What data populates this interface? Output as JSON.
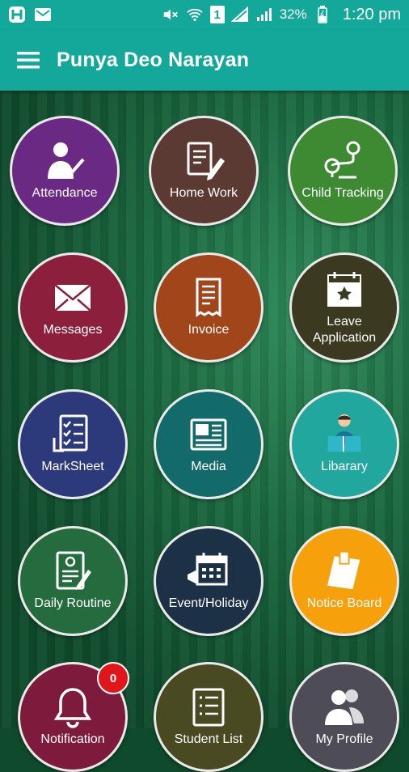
{
  "status_bar": {
    "battery": "32%",
    "time": "1:20 pm",
    "sim_slot": "1",
    "icons": [
      "app-icon",
      "mail-icon",
      "mute-icon",
      "wifi-icon",
      "sim-icon",
      "signal-icon",
      "signal-icon",
      "battery-icon"
    ]
  },
  "appbar": {
    "title": "Punya Deo Narayan"
  },
  "tiles": [
    {
      "label": "Attendance",
      "icon": "attendance-icon",
      "color": "#6a2a84"
    },
    {
      "label": "Home Work",
      "icon": "homework-icon",
      "color": "#5a3a32"
    },
    {
      "label": "Child Tracking",
      "icon": "route-icon",
      "color": "#3d8a33"
    },
    {
      "label": "Messages",
      "icon": "envelope-icon",
      "color": "#8c1f3c"
    },
    {
      "label": "Invoice",
      "icon": "receipt-icon",
      "color": "#a0461a"
    },
    {
      "label": "Leave Application",
      "icon": "calendar-star-icon",
      "color": "#3b3a20"
    },
    {
      "label": "MarkSheet",
      "icon": "checklist-icon",
      "color": "#2c3a7c"
    },
    {
      "label": "Media",
      "icon": "newspaper-icon",
      "color": "#136a6a"
    },
    {
      "label": "Libarary",
      "icon": "reader-icon",
      "color": "#21a79e"
    },
    {
      "label": "Daily Routine",
      "icon": "routine-icon",
      "color": "#246b3e"
    },
    {
      "label": "Event/Holiday",
      "icon": "event-calendar-icon",
      "color": "#1c3046"
    },
    {
      "label": "Notice Board",
      "icon": "notice-icon",
      "color": "#f6a00b"
    },
    {
      "label": "Notification",
      "icon": "bell-icon",
      "color": "#7e1a3c",
      "badge": "0"
    },
    {
      "label": "Student List",
      "icon": "list-icon",
      "color": "#4a4a22"
    },
    {
      "label": "My Profile",
      "icon": "profile-icon",
      "color": "#4e4c56"
    }
  ]
}
